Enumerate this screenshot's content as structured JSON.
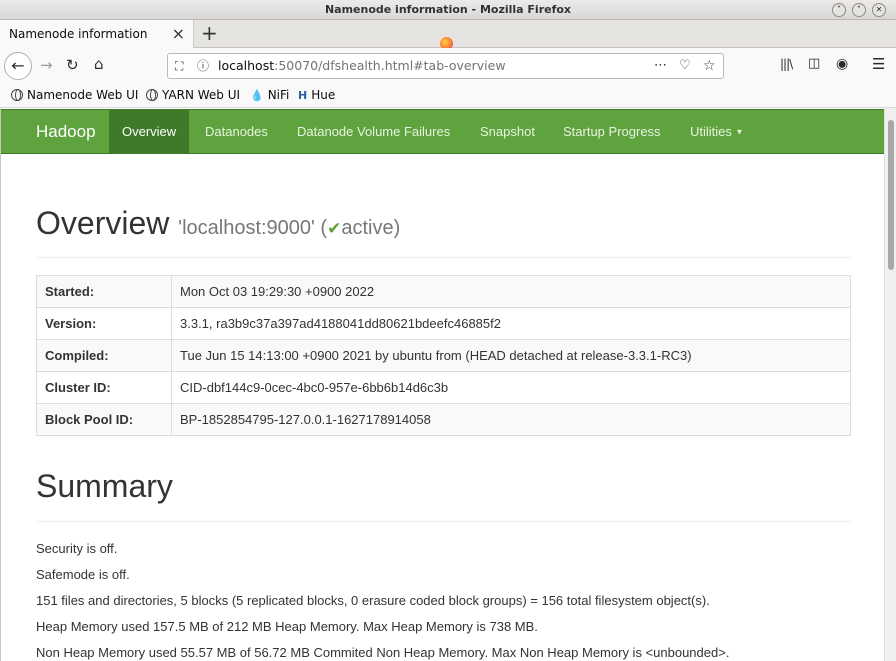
{
  "window": {
    "title": "Namenode information - Mozilla Firefox",
    "buttons": [
      "˅",
      "˄",
      "✕"
    ]
  },
  "tabs": [
    {
      "label": "Namenode information",
      "close": "×"
    }
  ],
  "new_tab": "+",
  "nav": {
    "url_host": "localhost",
    "url_rest": ":50070/dfshealth.html#tab-overview",
    "icons": [
      "back-icon",
      "forward-icon",
      "reload-icon",
      "home-icon",
      "shield-icon",
      "info-icon",
      "more-icon",
      "pocket-icon",
      "star-icon",
      "library-icon",
      "sidebar-icon",
      "account-icon",
      "menu-icon"
    ]
  },
  "bookmarks": [
    {
      "label": "Namenode Web UI"
    },
    {
      "label": "YARN Web UI"
    },
    {
      "label": "NiFi"
    },
    {
      "label": "Hue"
    }
  ],
  "hadoop_nav": {
    "brand": "Hadoop",
    "items": [
      {
        "label": "Overview"
      },
      {
        "label": "Datanodes"
      },
      {
        "label": "Datanode Volume Failures"
      },
      {
        "label": "Snapshot"
      },
      {
        "label": "Startup Progress"
      },
      {
        "label": "Utilities"
      }
    ]
  },
  "overview": {
    "heading": "Overview",
    "host": "'localhost:9000' (",
    "state": "active)",
    "rows": [
      {
        "label": "Started:",
        "value": "Mon Oct 03 19:29:30 +0900 2022"
      },
      {
        "label": "Version:",
        "value": "3.3.1, ra3b9c37a397ad4188041dd80621bdeefc46885f2"
      },
      {
        "label": "Compiled:",
        "value": "Tue Jun 15 14:13:00 +0900 2021 by ubuntu from (HEAD detached at release-3.3.1-RC3)"
      },
      {
        "label": "Cluster ID:",
        "value": "CID-dbf144c9-0cec-4bc0-957e-6bb6b14d6c3b"
      },
      {
        "label": "Block Pool ID:",
        "value": "BP-1852854795-127.0.0.1-1627178914058"
      }
    ]
  },
  "summary": {
    "heading": "Summary",
    "lines": [
      "Security is off.",
      "Safemode is off.",
      "151 files and directories, 5 blocks (5 replicated blocks, 0 erasure coded block groups) = 156 total filesystem object(s).",
      "Heap Memory used 157.5 MB of 212 MB Heap Memory. Max Heap Memory is 738 MB.",
      "Non Heap Memory used 55.57 MB of 56.72 MB Commited Non Heap Memory. Max Non Heap Memory is <unbounded>."
    ]
  }
}
